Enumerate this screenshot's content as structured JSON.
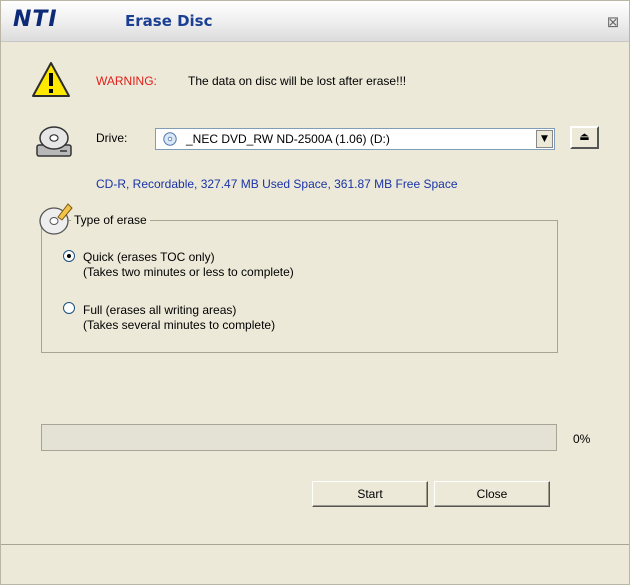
{
  "window": {
    "logo": "NTI",
    "title": "Erase Disc",
    "close_glyph": "⊠"
  },
  "warning": {
    "label": "WARNING:",
    "message": "The data on disc will be lost after erase!!!"
  },
  "drive": {
    "label": "Drive:",
    "selected": "_NEC DVD_RW ND-2500A (1.06) (D:)",
    "dropdown_glyph": "▼",
    "eject_glyph": "⏏"
  },
  "disc_info": "CD-R, Recordable, 327.47 MB Used Space, 361.87 MB Free Space",
  "erase_type": {
    "title": "Type of erase",
    "options": [
      {
        "line1": "Quick  (erases TOC only)",
        "line2": "(Takes two minutes or less to complete)",
        "selected": true
      },
      {
        "line1": "Full  (erases all writing areas)",
        "line2": "(Takes several minutes to complete)",
        "selected": false
      }
    ]
  },
  "progress": {
    "value": 0,
    "label": "0%"
  },
  "buttons": {
    "start": "Start",
    "close": "Close"
  },
  "colors": {
    "warning": "#e0201b",
    "info": "#1a33a6",
    "title": "#1b3f93",
    "logo": "#0d2a78"
  },
  "icons": [
    "warning-icon",
    "drive-icon",
    "cd-icon",
    "erase-disc-icon",
    "eject-icon",
    "close-icon"
  ]
}
